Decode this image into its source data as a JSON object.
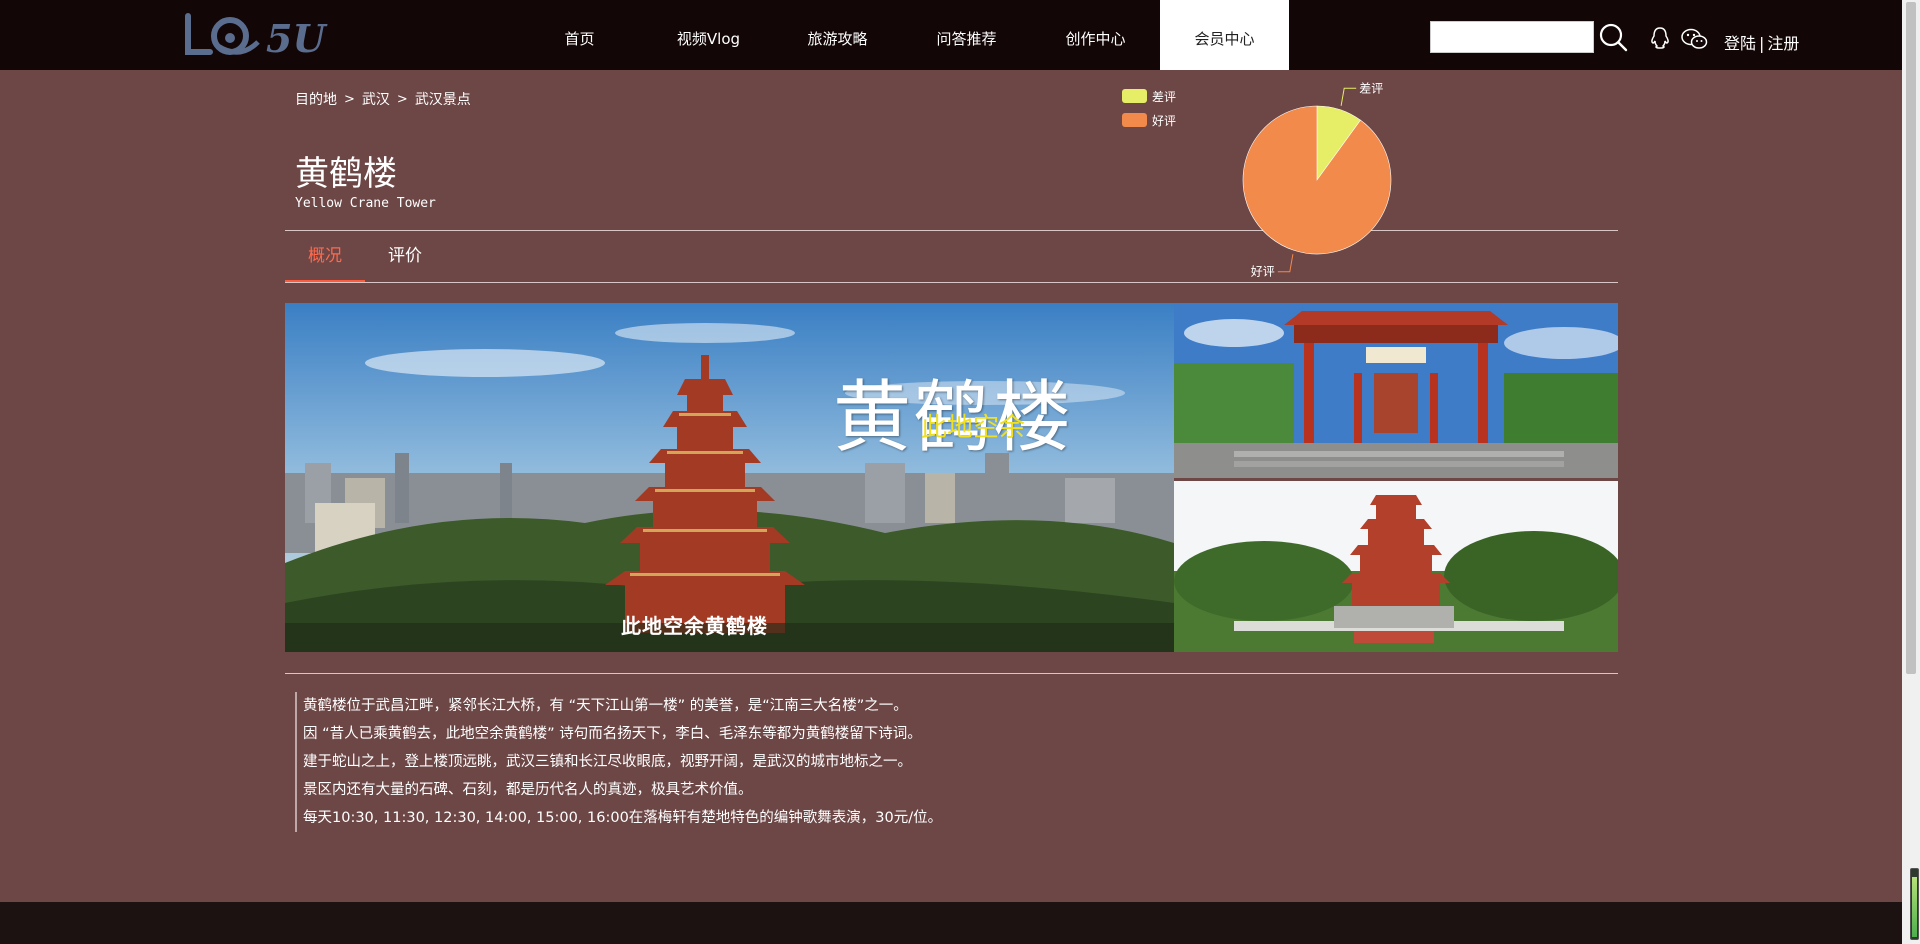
{
  "header": {
    "logo_text": "5U",
    "nav": [
      {
        "label": "首页"
      },
      {
        "label": "视频Vlog"
      },
      {
        "label": "旅游攻略"
      },
      {
        "label": "问答推荐"
      },
      {
        "label": "创作中心"
      },
      {
        "label": "会员中心",
        "active": true
      }
    ],
    "search": {
      "value": "",
      "placeholder": ""
    },
    "login_label": "登陆",
    "separator": "|",
    "register_label": "注册"
  },
  "breadcrumb": [
    "目的地",
    "武汉",
    "武汉景点"
  ],
  "breadcrumb_separator": ">",
  "title": {
    "cn": "黄鹤楼",
    "en": "Yellow Crane Tower"
  },
  "tabs": [
    {
      "label": "概况",
      "active": true
    },
    {
      "label": "评价"
    }
  ],
  "chart_data": {
    "type": "pie",
    "labels": [
      "差评",
      "好评"
    ],
    "values": [
      10,
      90
    ],
    "colors": [
      "#e5ee66",
      "#f28a4b"
    ],
    "legend": "top-left"
  },
  "gallery": {
    "main_overlay_title": "黄鹤楼",
    "main_overlay_subtitle": "此地空余",
    "main_caption": "此地空余黄鹤楼"
  },
  "description": [
    "黄鹤楼位于武昌江畔，紧邻长江大桥，有 “天下江山第一楼” 的美誉，是“江南三大名楼”之一。",
    "因 “昔人已乘黄鹤去，此地空余黄鹤楼” 诗句而名扬天下，李白、毛泽东等都为黄鹤楼留下诗词。",
    "建于蛇山之上，登上楼顶远眺，武汉三镇和长江尽收眼底，视野开阔，是武汉的城市地标之一。",
    "景区内还有大量的石碑、石刻，都是历代名人的真迹，极具艺术价值。",
    "每天10:30, 11:30, 12:30, 14:00, 15:00, 16:00在落梅轩有楚地特色的编钟歌舞表演，30元/位。"
  ],
  "colors": {
    "page_bg": "#6d4646",
    "header_bg": "#120606",
    "tab_active": "#ff6a4d",
    "footer_bg": "#1c1212"
  }
}
